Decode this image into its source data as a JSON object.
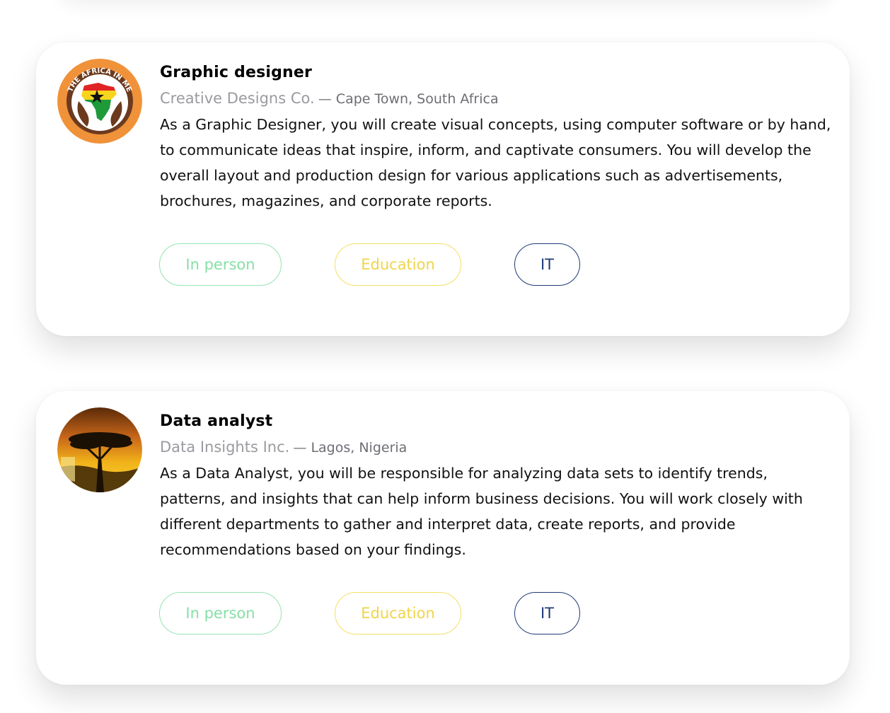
{
  "jobs": [
    {
      "title": "Graphic designer",
      "company": "Creative Designs Co.",
      "separator": "—",
      "location": "Cape Town, South Africa",
      "description": "As a Graphic Designer, you will create visual concepts, using computer software or by hand, to communicate ideas that inspire, inform, and captivate consumers. You will develop the overall layout and production design for various applications such as advertisements, brochures, magazines, and corporate reports.",
      "logo_icon": "africa-in-me-logo",
      "logo_text": "THE AFRICA IN ME",
      "tags": [
        {
          "label": "In person",
          "color": "#86dfa6"
        },
        {
          "label": "Education",
          "color": "#f0d44a"
        },
        {
          "label": "IT",
          "color": "#1f3a78"
        }
      ]
    },
    {
      "title": "Data analyst",
      "company": "Data Insights Inc.",
      "separator": "—",
      "location": "Lagos, Nigeria",
      "description": "As a Data Analyst, you will be responsible for analyzing data sets to identify trends, patterns, and insights that can help inform business decisions. You will work closely with different departments to gather and interpret data, create reports, and provide recommendations based on your findings.",
      "logo_icon": "acacia-sunset-logo",
      "tags": [
        {
          "label": "In person",
          "color": "#86dfa6"
        },
        {
          "label": "Education",
          "color": "#f0d44a"
        },
        {
          "label": "IT",
          "color": "#1f3a78"
        }
      ]
    }
  ]
}
